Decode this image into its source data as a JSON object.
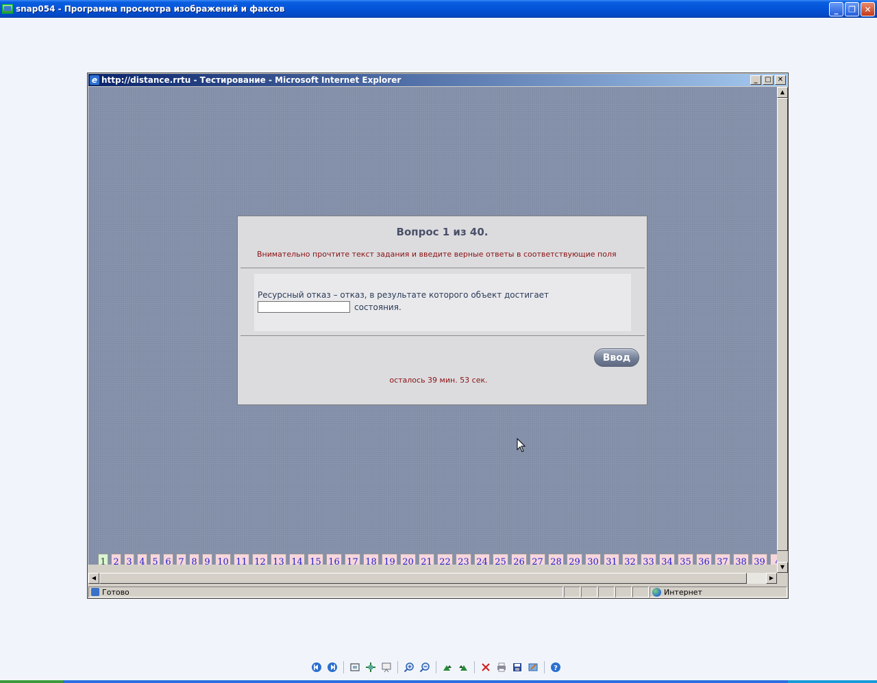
{
  "viewer": {
    "title": "snap054 - Программа просмотра изображений и факсов",
    "controls": {
      "minimize": "_",
      "restore": "❐",
      "close": "✕"
    }
  },
  "ie": {
    "title": "http://distance.rrtu - Тестирование - Microsoft Internet Explorer",
    "controls": {
      "minimize": "_",
      "maximize": "□",
      "close": "✕"
    },
    "status": {
      "text": "Готово",
      "zone": "Интернет"
    }
  },
  "test": {
    "question_title": "Вопрос 1 из 40.",
    "hint": "Внимательно прочтите текст задания и введите верные ответы в соответствующие поля",
    "question_text": "Ресурсный отказ – отказ, в результате которого объект достигает",
    "question_suffix": "состояния.",
    "answer_value": "",
    "submit_label": "Ввод",
    "timer": "осталось 39 мин. 53 сек."
  },
  "question_numbers": [
    "1",
    "2",
    "3",
    "4",
    "5",
    "6",
    "7",
    "8",
    "9",
    "10",
    "11",
    "12",
    "13",
    "14",
    "15",
    "16",
    "17",
    "18",
    "19",
    "20",
    "21",
    "22",
    "23",
    "24",
    "25",
    "26",
    "27",
    "28",
    "29",
    "30",
    "31",
    "32",
    "33",
    "34",
    "35",
    "36",
    "37",
    "38",
    "39",
    "4"
  ],
  "current_question": "1",
  "toolbar_icons": [
    "prev-image-icon",
    "next-image-icon",
    "best-fit-icon",
    "actual-size-icon",
    "slideshow-icon",
    "zoom-in-icon",
    "zoom-out-icon",
    "rotate-clockwise-icon",
    "rotate-counterclockwise-icon",
    "delete-icon",
    "print-icon",
    "save-icon",
    "edit-icon",
    "help-icon"
  ],
  "colors": {
    "page_bg": "#828ea8",
    "panel_bg": "#dcdcdf",
    "accent_text": "#8a1010",
    "qnum_bg": "#f6d6dc",
    "qnum_current_bg": "#d8f5d0",
    "qnum_text": "#2020c8"
  }
}
